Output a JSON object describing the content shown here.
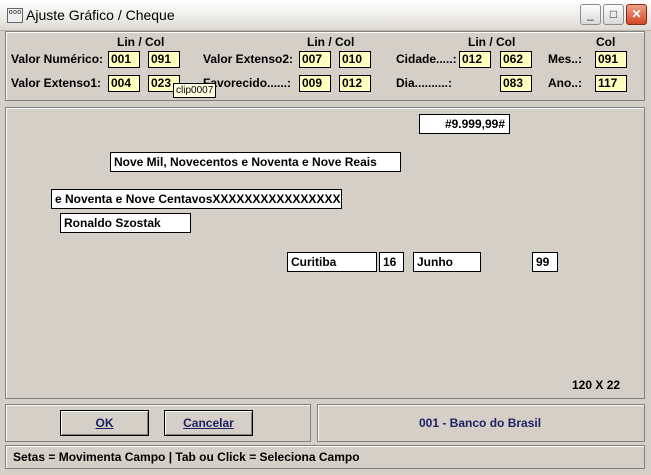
{
  "window": {
    "title": "Ajuste Gráfico / Cheque",
    "icon_text": "ooo"
  },
  "controls": {
    "minimize": "_",
    "maximize": "□",
    "close": "✕"
  },
  "settings": {
    "col_header_lincol": "Lin / Col",
    "col_header_col": "Col",
    "valor_numerico": {
      "label": "Valor Numérico:",
      "lin": "001",
      "col": "091"
    },
    "valor_extenso1": {
      "label": "Valor Extenso1:",
      "lin": "004",
      "col": "023"
    },
    "valor_extenso2": {
      "label": "Valor Extenso2:",
      "lin": "007",
      "col": "010"
    },
    "favorecido": {
      "label": "Favorecido......:",
      "lin": "009",
      "col": "012"
    },
    "cidade": {
      "label": "Cidade.....:",
      "lin": "012",
      "col": "062"
    },
    "dia": {
      "label": "Dia..........:",
      "lin": "",
      "col": "083"
    },
    "mes": {
      "label": "Mes..:",
      "col": "091"
    },
    "ano": {
      "label": "Ano..:",
      "col": "117"
    },
    "tooltip": "clip0007"
  },
  "preview": {
    "valor": "#9.999,99#",
    "extenso1": "Nove Mil, Novecentos e Noventa e Nove Reais",
    "extenso2": "e Noventa e Nove CentavosXXXXXXXXXXXXXXXX",
    "favorecido": "Ronaldo Szostak",
    "cidade": "Curitiba",
    "dia": "16",
    "mes": "Junho",
    "ano": "99",
    "dimensions": "120 X 22"
  },
  "actions": {
    "ok": "OK",
    "cancel": "Cancelar"
  },
  "bank": "001 - Banco do Brasil",
  "status": "Setas = Movimenta Campo | Tab ou Click = Seleciona Campo"
}
